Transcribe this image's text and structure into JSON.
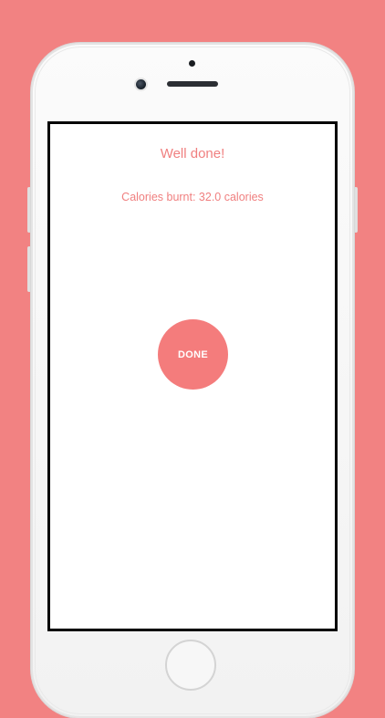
{
  "screen": {
    "title": "Well done!",
    "calories_text": "Calories burnt: 32.0 calories",
    "done_label": "DONE"
  },
  "colors": {
    "background": "#f28282",
    "accent": "#f47c7c",
    "text": "#f07f7f"
  }
}
